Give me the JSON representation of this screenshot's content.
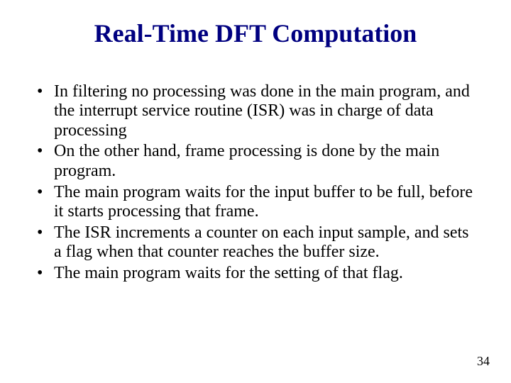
{
  "title": "Real-Time DFT Computation",
  "bullets": [
    "In filtering no processing was done in the main program, and the interrupt service routine (ISR) was in charge of data processing",
    "On the other hand, frame processing is done by the main program.",
    "The main program waits for the input buffer to be full, before it starts processing that frame.",
    "The ISR increments a counter on each input sample, and sets a flag when that counter reaches the buffer size.",
    "The main program waits for the setting of that flag."
  ],
  "page_number": "34"
}
